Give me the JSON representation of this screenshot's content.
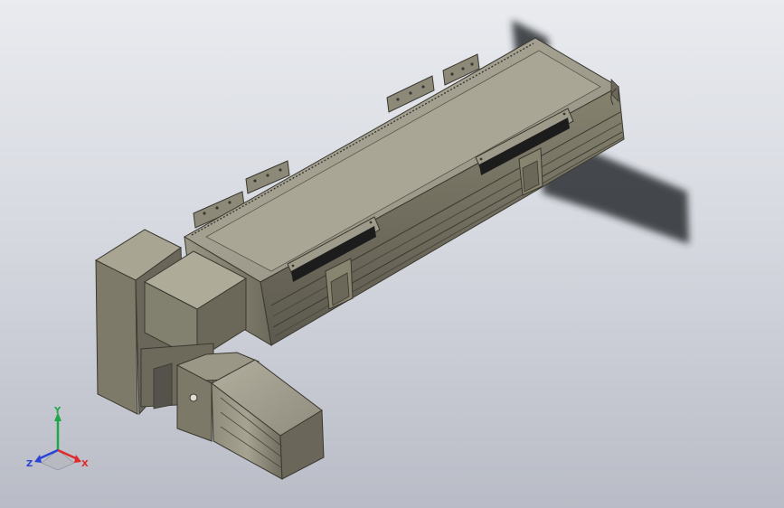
{
  "viewport": {
    "background_top": "#e9ebef",
    "background_bottom": "#b9bcc6"
  },
  "model": {
    "body_color": "#7d7a6c",
    "body_light": "#a3a08f",
    "body_dark": "#4f4c42",
    "slot_color": "#1c1c1c",
    "shadow_color": "#2b2d33"
  },
  "triad": {
    "x_label": "X",
    "y_label": "Y",
    "z_label": "Z",
    "x_color": "#e0292b",
    "y_color": "#22a64a",
    "z_color": "#2a43d6"
  }
}
